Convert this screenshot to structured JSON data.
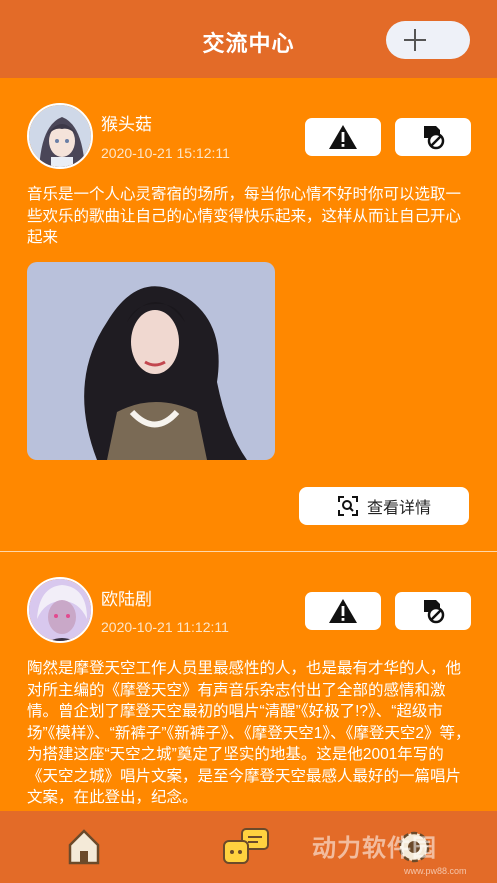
{
  "header": {
    "title": "交流中心"
  },
  "posts": [
    {
      "username": "猴头菇",
      "timestamp": "2020-10-21 15:12:11",
      "text": "音乐是一个人心灵寄宿的场所，每当你心情不好时你可以选取一些欢乐的歌曲让自己的心情变得快乐起来，这样从而让自己开心起来",
      "detail_label": "查看详情"
    },
    {
      "username": "欧陆剧",
      "timestamp": "2020-10-21 11:12:11",
      "text": "陶然是摩登天空工作人员里最感性的人，也是最有才华的人，他对所主编的《摩登天空》有声音乐杂志付出了全部的感情和激情。曾企划了摩登天空最初的唱片“清醒”《好极了!?》、“超级市场”《模样》、“新裤子”《新裤子》、《摩登天空1》、《摩登天空2》等，为搭建这座“天空之城”奠定了坚实的地基。这是他2001年写的《天空之城》唱片文案，是至今摩登天空最感人最好的一篇唱片文案，在此登出，纪念。"
    }
  ],
  "watermark": {
    "text": "动力软件园",
    "url": "www.pw88.com"
  },
  "icons": {
    "add": "plus-icon",
    "report": "warning-icon",
    "block": "block-icon",
    "detail": "scan-icon",
    "tab_home": "home-icon",
    "tab_chat": "chat-icon",
    "tab_settings": "settings-icon"
  },
  "colors": {
    "header": "#e36b28",
    "background": "#ff8800"
  }
}
